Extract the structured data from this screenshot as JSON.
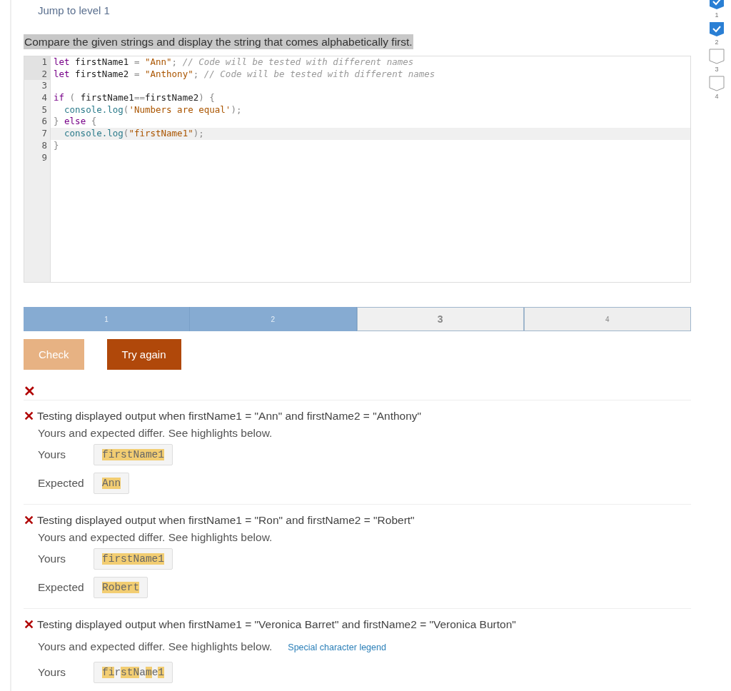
{
  "jump_link": "Jump to level 1",
  "instructions": "Compare the given strings and display the string that comes alphabetically first.",
  "code_lines": [
    {
      "number": "1",
      "readonly": true,
      "active": false,
      "indented": false,
      "tokens": [
        {
          "kind": "keyword",
          "text": "let"
        },
        {
          "kind": "plain",
          "text": " firstName1 "
        },
        {
          "kind": "operator",
          "text": "= "
        },
        {
          "kind": "string",
          "text": "\"Ann\""
        },
        {
          "kind": "operator",
          "text": "; "
        },
        {
          "kind": "comment",
          "text": "// Code will be tested with different names"
        }
      ]
    },
    {
      "number": "2",
      "readonly": true,
      "active": false,
      "indented": false,
      "tokens": [
        {
          "kind": "keyword",
          "text": "let"
        },
        {
          "kind": "plain",
          "text": " firstName2 "
        },
        {
          "kind": "operator",
          "text": "= "
        },
        {
          "kind": "string",
          "text": "\"Anthony\""
        },
        {
          "kind": "operator",
          "text": "; "
        },
        {
          "kind": "comment",
          "text": "// Code will be tested with different names"
        }
      ]
    },
    {
      "number": "3",
      "readonly": false,
      "active": false
    },
    {
      "number": "4",
      "readonly": false,
      "active": false,
      "indented": false,
      "tokens": [
        {
          "kind": "keyword",
          "text": "if"
        },
        {
          "kind": "operator",
          "text": " ( "
        },
        {
          "kind": "plain",
          "text": "firstName1"
        },
        {
          "kind": "operator",
          "text": "=="
        },
        {
          "kind": "plain",
          "text": "firstName2"
        },
        {
          "kind": "operator",
          "text": ") {"
        }
      ]
    },
    {
      "number": "5",
      "readonly": false,
      "active": false,
      "indented": true,
      "tokens": [
        {
          "kind": "builtin",
          "text": "console.log"
        },
        {
          "kind": "operator",
          "text": "("
        },
        {
          "kind": "string",
          "text": "'Numbers are equal'"
        },
        {
          "kind": "operator",
          "text": ");"
        }
      ]
    },
    {
      "number": "6",
      "readonly": false,
      "active": false,
      "indented": false,
      "tokens": [
        {
          "kind": "operator",
          "text": "} "
        },
        {
          "kind": "keyword",
          "text": "else"
        },
        {
          "kind": "operator",
          "text": " {"
        }
      ]
    },
    {
      "number": "7",
      "readonly": false,
      "active": true,
      "indented": true,
      "tokens": [
        {
          "kind": "builtin",
          "text": "console.log"
        },
        {
          "kind": "operator",
          "text": "("
        },
        {
          "kind": "string",
          "text": "\"firstName1\""
        },
        {
          "kind": "operator",
          "text": ");"
        }
      ]
    },
    {
      "number": "8",
      "readonly": false,
      "active": false,
      "indented": false,
      "tokens": [
        {
          "kind": "operator",
          "text": "}"
        }
      ]
    },
    {
      "number": "9",
      "readonly": false,
      "active": false
    }
  ],
  "progress": [
    {
      "label": "1",
      "completed": true,
      "selected": false
    },
    {
      "label": "2",
      "completed": true,
      "selected": false
    },
    {
      "label": "3",
      "completed": false,
      "selected": true
    },
    {
      "label": "4",
      "completed": false,
      "selected": false
    }
  ],
  "buttons": [
    {
      "label": "Check",
      "disabled": true
    },
    {
      "label": "Try again",
      "disabled": false
    }
  ],
  "result_mark": "✕",
  "tests": [
    {
      "mark": "✕",
      "title": "Testing displayed output when firstName1 = \"Ann\" and firstName2 = \"Anthony\"",
      "message": "Yours and expected differ. See highlights below.",
      "outputs": [
        {
          "label": "Yours",
          "segments": [
            {
              "text": "firstName1",
              "highlighted": true
            }
          ]
        },
        {
          "label": "Expected",
          "segments": [
            {
              "text": "Ann",
              "highlighted": true
            }
          ]
        }
      ]
    },
    {
      "mark": "✕",
      "title": "Testing displayed output when firstName1 = \"Ron\" and firstName2 = \"Robert\"",
      "message": "Yours and expected differ. See highlights below.",
      "outputs": [
        {
          "label": "Yours",
          "segments": [
            {
              "text": "firstName1",
              "highlighted": true
            }
          ]
        },
        {
          "label": "Expected",
          "segments": [
            {
              "text": "Robert",
              "highlighted": true
            }
          ]
        }
      ]
    },
    {
      "mark": "✕",
      "title": "Testing displayed output when firstName1 = \"Veronica Barret\" and firstName2 = \"Veronica Burton\"",
      "message": "Yours and expected differ. See highlights below.",
      "legend_link": "Special character legend",
      "outputs": [
        {
          "label": "Yours",
          "segments": [
            {
              "text": "fi",
              "highlighted": true
            },
            {
              "text": "r",
              "highlighted": false
            },
            {
              "text": "stN",
              "highlighted": true
            },
            {
              "text": "a",
              "highlighted": false
            },
            {
              "text": "m",
              "highlighted": true
            },
            {
              "text": "e",
              "highlighted": false
            },
            {
              "text": "1",
              "highlighted": true
            }
          ]
        }
      ]
    }
  ],
  "levels": [
    {
      "label": "1",
      "completed": true
    },
    {
      "label": "2",
      "completed": true
    },
    {
      "label": "3",
      "completed": false
    },
    {
      "label": "4",
      "completed": false
    }
  ]
}
